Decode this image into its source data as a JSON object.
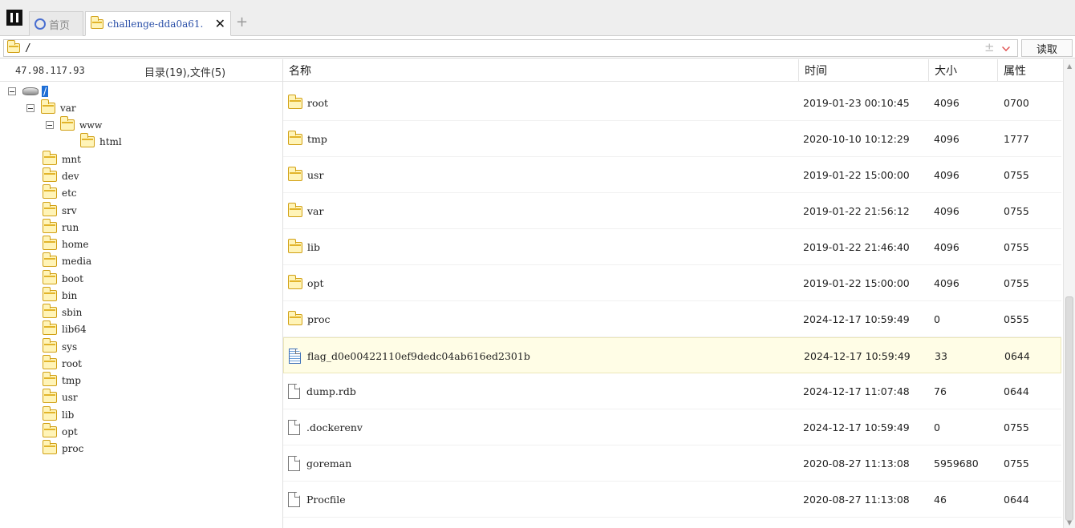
{
  "tabs": {
    "home_label": "首页",
    "active_label": "challenge-dda0a61.",
    "close_glyph": "✕",
    "add_glyph": "+"
  },
  "address": {
    "path": "/",
    "pm_glyph": "±",
    "read_label": "读取"
  },
  "left": {
    "host": "47.98.117.93",
    "counts": "目录(19),文件(5)",
    "root_label": "/",
    "tree": [
      {
        "label": "var"
      },
      {
        "label": "www"
      },
      {
        "label": "html"
      },
      {
        "label": "mnt"
      },
      {
        "label": "dev"
      },
      {
        "label": "etc"
      },
      {
        "label": "srv"
      },
      {
        "label": "run"
      },
      {
        "label": "home"
      },
      {
        "label": "media"
      },
      {
        "label": "boot"
      },
      {
        "label": "bin"
      },
      {
        "label": "sbin"
      },
      {
        "label": "lib64"
      },
      {
        "label": "sys"
      },
      {
        "label": "root"
      },
      {
        "label": "tmp"
      },
      {
        "label": "usr"
      },
      {
        "label": "lib"
      },
      {
        "label": "opt"
      },
      {
        "label": "proc"
      }
    ]
  },
  "table": {
    "headers": {
      "name": "名称",
      "time": "时间",
      "size": "大小",
      "attr": "属性"
    },
    "rows": [
      {
        "name": "root",
        "time": "2019-01-23 00:10:45",
        "size": "4096",
        "attr": "0700",
        "type": "folder"
      },
      {
        "name": "tmp",
        "time": "2020-10-10 10:12:29",
        "size": "4096",
        "attr": "1777",
        "type": "folder"
      },
      {
        "name": "usr",
        "time": "2019-01-22 15:00:00",
        "size": "4096",
        "attr": "0755",
        "type": "folder"
      },
      {
        "name": "var",
        "time": "2019-01-22 21:56:12",
        "size": "4096",
        "attr": "0755",
        "type": "folder"
      },
      {
        "name": "lib",
        "time": "2019-01-22 21:46:40",
        "size": "4096",
        "attr": "0755",
        "type": "folder"
      },
      {
        "name": "opt",
        "time": "2019-01-22 15:00:00",
        "size": "4096",
        "attr": "0755",
        "type": "folder"
      },
      {
        "name": "proc",
        "time": "2024-12-17 10:59:49",
        "size": "0",
        "attr": "0555",
        "type": "folder"
      },
      {
        "name": "flag_d0e00422110ef9dedc04ab616ed2301b",
        "time": "2024-12-17 10:59:49",
        "size": "33",
        "attr": "0644",
        "type": "text-file"
      },
      {
        "name": "dump.rdb",
        "time": "2024-12-17 11:07:48",
        "size": "76",
        "attr": "0644",
        "type": "file"
      },
      {
        "name": ".dockerenv",
        "time": "2024-12-17 10:59:49",
        "size": "0",
        "attr": "0755",
        "type": "file"
      },
      {
        "name": "goreman",
        "time": "2020-08-27 11:13:08",
        "size": "5959680",
        "attr": "0755",
        "type": "file"
      },
      {
        "name": "Procfile",
        "time": "2020-08-27 11:13:08",
        "size": "46",
        "attr": "0644",
        "type": "file"
      }
    ]
  },
  "colors": {
    "accent": "#1f6fd6",
    "folder_fill": "#fff4b8",
    "folder_stroke": "#d1a015",
    "selected_row": "#fffde6"
  }
}
